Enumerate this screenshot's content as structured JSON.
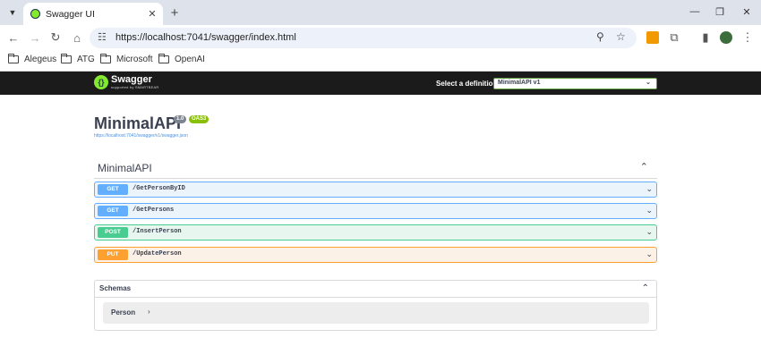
{
  "browser": {
    "tab_title": "Swagger UI",
    "url": "https://localhost:7041/swagger/index.html",
    "bookmarks": [
      "Alegeus",
      "ATG",
      "Microsoft",
      "OpenAI"
    ]
  },
  "swagger": {
    "brand": "Swagger",
    "brand_sub": "supported by SMARTBEAR",
    "definition_label": "Select a definition",
    "definition_value": "MinimalAPI v1",
    "api_title": "MinimalAPI",
    "version": "1.0",
    "oas": "OAS3",
    "spec_url": "https://localhost:7041/swagger/v1/swagger.json",
    "tag": "MinimalAPI",
    "operations": [
      {
        "method": "GET",
        "path": "/GetPersonByID"
      },
      {
        "method": "GET",
        "path": "/GetPersons"
      },
      {
        "method": "POST",
        "path": "/InsertPerson"
      },
      {
        "method": "PUT",
        "path": "/UpdatePerson"
      }
    ],
    "schemas_title": "Schemas",
    "models": [
      "Person"
    ]
  },
  "colors": {
    "get": "#61affe",
    "post": "#49cc90",
    "put": "#fca130",
    "topbar": "#1b1b1b",
    "swagger_green": "#85ea2d"
  }
}
